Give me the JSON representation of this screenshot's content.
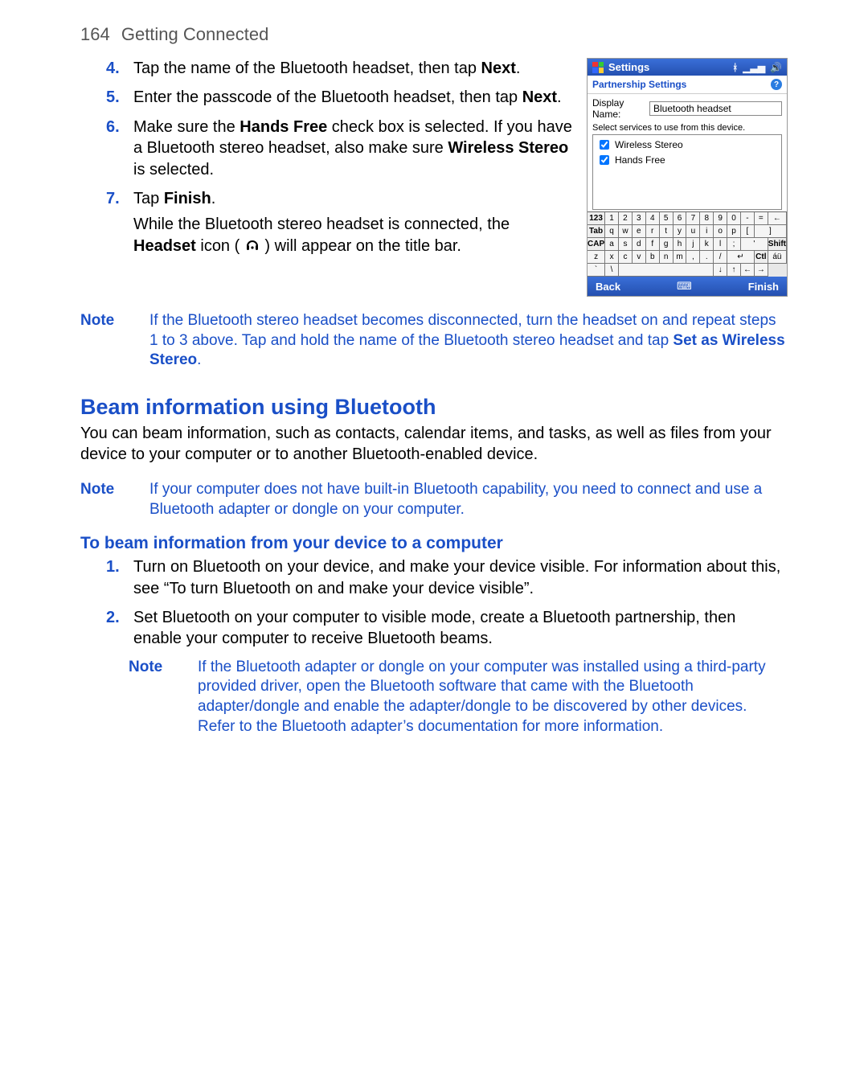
{
  "header": {
    "page_number": "164",
    "chapter": "Getting Connected"
  },
  "steps": {
    "s4": {
      "num": "4.",
      "text_a": "Tap the name of the Bluetooth headset, then tap ",
      "bold": "Next",
      "text_b": "."
    },
    "s5": {
      "num": "5.",
      "text_a": "Enter the passcode of the Bluetooth headset, then tap ",
      "bold": "Next",
      "text_b": "."
    },
    "s6": {
      "num": "6.",
      "text_a": "Make sure the ",
      "bold1": "Hands Free",
      "text_b": " check box is selected. If you have a Bluetooth stereo headset, also make sure ",
      "bold2": "Wireless Stereo",
      "text_c": " is selected."
    },
    "s7": {
      "num": "7.",
      "text_a": "Tap ",
      "bold": "Finish",
      "text_b": ".",
      "follow_a": "While the Bluetooth stereo headset is connected, the ",
      "follow_bold": "Headset",
      "follow_b": " icon ( ",
      "follow_c": " ) will appear on the title bar."
    }
  },
  "note1": {
    "label": "Note",
    "body_a": "If the Bluetooth stereo headset becomes disconnected, turn the headset on and repeat steps 1 to 3 above. Tap and hold the name of the Bluetooth stereo headset and tap ",
    "body_bold": "Set as Wireless Stereo",
    "body_b": "."
  },
  "section": {
    "title": "Beam information using Bluetooth",
    "intro": "You can beam information, such as contacts, calendar items, and tasks, as well as files from your device to your computer or to another Bluetooth-enabled device."
  },
  "note2": {
    "label": "Note",
    "body": "If your computer does not have built-in Bluetooth capability, you need to connect and use a Bluetooth adapter or dongle on your computer."
  },
  "sub": {
    "title": "To beam information from your device to a computer",
    "s1": {
      "num": "1.",
      "text": "Turn on Bluetooth on your device, and make your device visible. For information about this, see “To turn Bluetooth on and make your device visible”."
    },
    "s2": {
      "num": "2.",
      "text": "Set Bluetooth on your computer to visible mode, create a Bluetooth partnership, then enable your computer to receive Bluetooth beams."
    }
  },
  "note3": {
    "label": "Note",
    "body": "If the Bluetooth adapter or dongle on your computer was installed using a third-party provided driver, open the Bluetooth software that came with the Bluetooth adapter/dongle and enable the adapter/dongle to be discovered by other devices. Refer to the Bluetooth adapter’s documentation for more information."
  },
  "device": {
    "title": "Settings",
    "sub": "Partnership Settings",
    "display_label": "Display Name:",
    "display_value": "Bluetooth headset",
    "services_label": "Select services to use from this device.",
    "svc1": "Wireless Stereo",
    "svc2": "Hands Free",
    "kb": {
      "row1": [
        "123",
        "1",
        "2",
        "3",
        "4",
        "5",
        "6",
        "7",
        "8",
        "9",
        "0",
        "-",
        "=",
        "←"
      ],
      "row2": [
        "Tab",
        "q",
        "w",
        "e",
        "r",
        "t",
        "y",
        "u",
        "i",
        "o",
        "p",
        "[",
        "]"
      ],
      "row3": [
        "CAP",
        "a",
        "s",
        "d",
        "f",
        "g",
        "h",
        "j",
        "k",
        "l",
        ";",
        "'"
      ],
      "row4": [
        "Shift",
        "z",
        "x",
        "c",
        "v",
        "b",
        "n",
        "m",
        ",",
        ".",
        "/",
        "↵"
      ],
      "row5_a": "Ctl",
      "row5_b": "áü",
      "row5_c": "`",
      "row5_d": "\\",
      "row5_arrows": [
        "↓",
        "↑",
        "←",
        "→"
      ]
    },
    "foot_left": "Back",
    "foot_mid": "⌨",
    "foot_right": "Finish"
  }
}
